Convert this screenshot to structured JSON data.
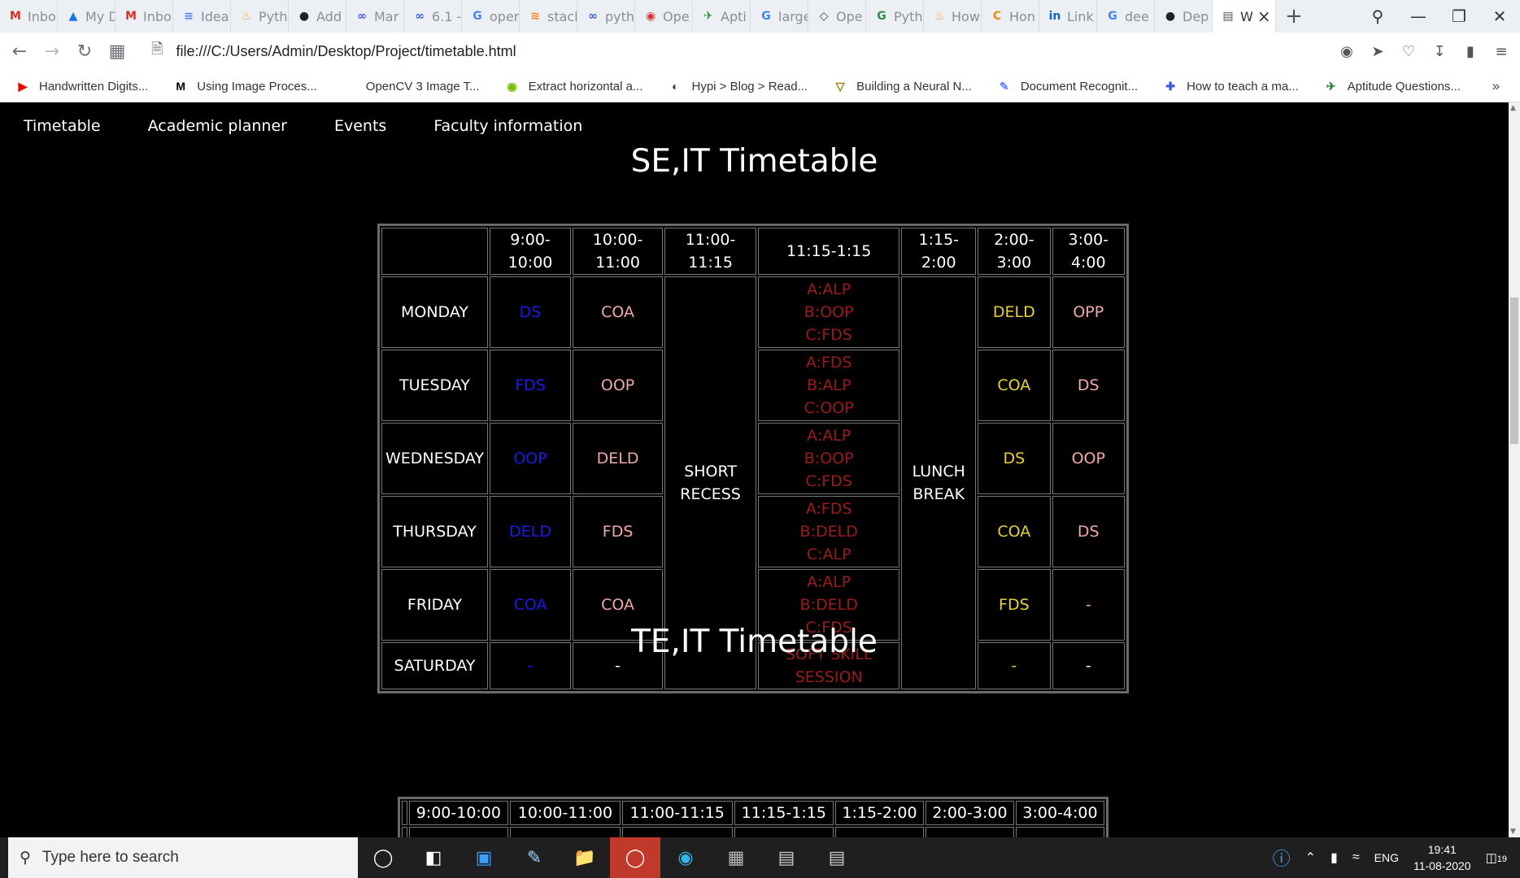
{
  "browser": {
    "tabs": [
      {
        "label": "Inbo",
        "icon": "gmail-icon"
      },
      {
        "label": "My D",
        "icon": "drive-icon"
      },
      {
        "label": "Inbo",
        "icon": "gmail-icon"
      },
      {
        "label": "Idea",
        "icon": "docs-icon"
      },
      {
        "label": "Pyth",
        "icon": "python-icon"
      },
      {
        "label": "Add",
        "icon": "github-icon"
      },
      {
        "label": "Mar",
        "icon": "infinity-icon"
      },
      {
        "label": "6.1 -",
        "icon": "infinity-icon"
      },
      {
        "label": "oper",
        "icon": "google-icon"
      },
      {
        "label": "stack",
        "icon": "stackoverflow-icon"
      },
      {
        "label": "pyth",
        "icon": "infinity-icon"
      },
      {
        "label": "Ope",
        "icon": "opencv-icon"
      },
      {
        "label": "Apti",
        "icon": "indiabix-icon"
      },
      {
        "label": "large",
        "icon": "google-icon"
      },
      {
        "label": "Ope",
        "icon": "diamond-icon"
      },
      {
        "label": "Pyth",
        "icon": "geeks-icon"
      },
      {
        "label": "How",
        "icon": "python-icon"
      },
      {
        "label": "Hon",
        "icon": "hackerrank-icon"
      },
      {
        "label": "Link",
        "icon": "linkedin-icon"
      },
      {
        "label": "dee",
        "icon": "google-icon"
      },
      {
        "label": "Dep",
        "icon": "github-icon"
      },
      {
        "label": "W",
        "icon": "file-icon",
        "active": true
      }
    ],
    "url": "file:///C:/Users/Admin/Desktop/Project/timetable.html",
    "bookmarks": [
      {
        "label": "Handwritten Digits...",
        "icon": "youtube-icon"
      },
      {
        "label": "Using Image Proces...",
        "icon": "medium-icon"
      },
      {
        "label": "OpenCV 3 Image T...",
        "icon": ""
      },
      {
        "label": "Extract horizontal a...",
        "icon": "nvidia-icon"
      },
      {
        "label": "Hypi > Blog > Read...",
        "icon": "hypi-icon"
      },
      {
        "label": "Building a Neural N...",
        "icon": "triangle-icon"
      },
      {
        "label": "Document Recognit...",
        "icon": "doc-icon"
      },
      {
        "label": "How to teach a ma...",
        "icon": "puzzle-icon"
      },
      {
        "label": "Aptitude Questions...",
        "icon": "indiabix-icon"
      }
    ]
  },
  "nav": {
    "items": [
      "Timetable",
      "Academic planner",
      "Events",
      "Faculty information"
    ]
  },
  "se": {
    "title": "SE,IT Timetable",
    "headers": [
      "",
      "9:00-10:00",
      "10:00-11:00",
      "11:00-11:15",
      "11:15-1:15",
      "1:15-2:00",
      "2:00-3:00",
      "3:00-4:00"
    ],
    "short_recess": "SHORT\nRECESS",
    "lunch_break": "LUNCH\nBREAK",
    "rows": [
      {
        "day": "MONDAY",
        "p1": "DS",
        "p2": "COA",
        "lab": [
          "A:ALP",
          "B:OOP",
          "C:FDS"
        ],
        "p3": "DELD",
        "p4": "OPP"
      },
      {
        "day": "TUESDAY",
        "p1": "FDS",
        "p2": "OOP",
        "lab": [
          "A:FDS",
          "B:ALP",
          "C:OOP"
        ],
        "p3": "COA",
        "p4": "DS"
      },
      {
        "day": "WEDNESDAY",
        "p1": "OOP",
        "p2": "DELD",
        "lab": [
          "A:ALP",
          "B:OOP",
          "C:FDS"
        ],
        "p3": "DS",
        "p4": "OOP"
      },
      {
        "day": "THURSDAY",
        "p1": "DELD",
        "p2": "FDS",
        "lab": [
          "A:FDS",
          "B:DELD",
          "C:ALP"
        ],
        "p3": "COA",
        "p4": "DS"
      },
      {
        "day": "FRIDAY",
        "p1": "COA",
        "p2": "COA",
        "lab": [
          "A:ALP",
          "B:DELD",
          "C:FDS"
        ],
        "p3": "FDS",
        "p4": "-"
      }
    ],
    "saturday": {
      "day": "SATURDAY",
      "p1": "-",
      "p2": "-",
      "lab": "SOFT SKILL SESSION",
      "p3": "-",
      "p4": "-"
    }
  },
  "te": {
    "title": "TE,IT Timetable",
    "headers": [
      "",
      "9:00-10:00",
      "10:00-11:00",
      "11:00-11:15",
      "11:15-1:15",
      "1:15-2:00",
      "2:00-3:00",
      "3:00-4:00"
    ]
  },
  "taskbar": {
    "search_placeholder": "Type here to search",
    "language": "ENG",
    "time": "19:41",
    "date": "11-08-2020",
    "notifications": "19"
  }
}
